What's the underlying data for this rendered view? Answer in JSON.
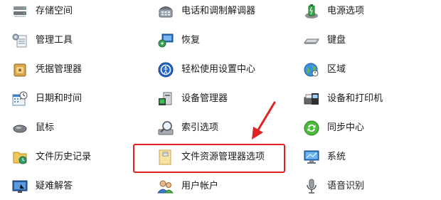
{
  "columns": [
    {
      "items": [
        {
          "label": "存储空间",
          "icon": "storage-spaces-icon"
        },
        {
          "label": "管理工具",
          "icon": "admin-tools-icon"
        },
        {
          "label": "凭据管理器",
          "icon": "credential-manager-icon"
        },
        {
          "label": "日期和时间",
          "icon": "date-time-icon"
        },
        {
          "label": "鼠标",
          "icon": "mouse-icon"
        },
        {
          "label": "文件历史记录",
          "icon": "file-history-icon"
        },
        {
          "label": "疑难解答",
          "icon": "troubleshooting-icon"
        }
      ]
    },
    {
      "items": [
        {
          "label": "电话和调制解调器",
          "icon": "phone-modem-icon"
        },
        {
          "label": "恢复",
          "icon": "recovery-icon"
        },
        {
          "label": "轻松使用设置中心",
          "icon": "ease-of-access-icon"
        },
        {
          "label": "设备管理器",
          "icon": "device-manager-icon"
        },
        {
          "label": "索引选项",
          "icon": "indexing-options-icon"
        },
        {
          "label": "文件资源管理器选项",
          "icon": "file-explorer-options-icon"
        },
        {
          "label": "用户帐户",
          "icon": "user-accounts-icon"
        }
      ]
    },
    {
      "items": [
        {
          "label": "电源选项",
          "icon": "power-options-icon"
        },
        {
          "label": "键盘",
          "icon": "keyboard-icon"
        },
        {
          "label": "区域",
          "icon": "region-icon"
        },
        {
          "label": "设备和打印机",
          "icon": "devices-printers-icon"
        },
        {
          "label": "同步中心",
          "icon": "sync-center-icon"
        },
        {
          "label": "系统",
          "icon": "system-icon"
        },
        {
          "label": "语音识别",
          "icon": "speech-recognition-icon"
        }
      ]
    }
  ],
  "annotation": {
    "highlight_color": "#e02222"
  }
}
